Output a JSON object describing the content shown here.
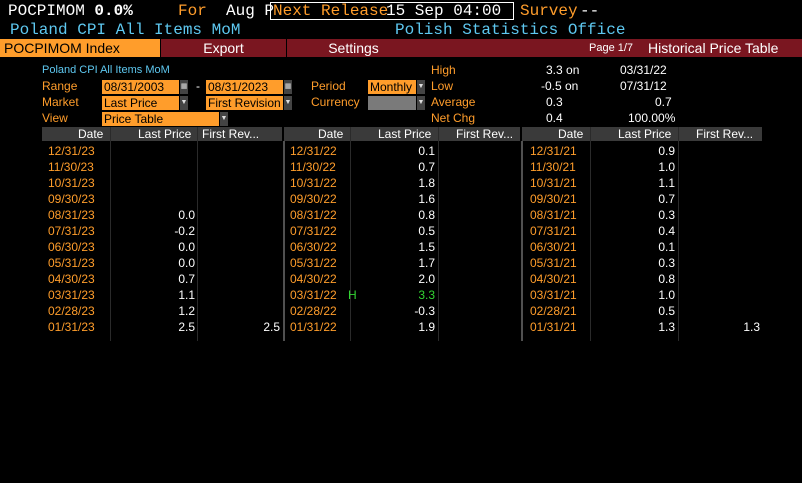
{
  "header": {
    "ticker": "POCPIMOM",
    "last": "0.0%",
    "for_label": "For",
    "for_value": "Aug P",
    "next_release_label": "Next Release",
    "next_release_value": "15 Sep 04:00",
    "survey_label": "Survey",
    "survey_value": "--",
    "security_name": "Poland CPI All Items MoM",
    "source": "Polish Statistics Office"
  },
  "menu": {
    "index_label": "POCPIMOM Index",
    "export_label": "Export",
    "settings_label": "Settings",
    "page_label": "Page 1/7",
    "view_title": "Historical Price Table"
  },
  "controls": {
    "title": "Poland CPI All Items MoM",
    "range_label": "Range",
    "range_start": "08/31/2003",
    "range_sep": "-",
    "range_end": "08/31/2023",
    "period_label": "Period",
    "period_value": "Monthly",
    "market_label": "Market",
    "market_value": "Last Price",
    "market2_value": "First Revision",
    "currency_label": "Currency",
    "currency_value": "",
    "view_label": "View",
    "view_value": "Price Table"
  },
  "stats": {
    "high_label": "High",
    "high_value": "3.3 on",
    "high_date": "03/31/22",
    "low_label": "Low",
    "low_value": "-0.5 on",
    "low_date": "07/31/12",
    "avg_label": "Average",
    "avg_value": "0.3",
    "avg_value2": "0.7",
    "netchg_label": "Net Chg",
    "netchg_value": "0.4",
    "netchg_pct": "100.00%"
  },
  "table": {
    "headers": [
      "Date",
      "Last Price",
      "First Rev..."
    ],
    "col1": [
      {
        "date": "12/31/23",
        "last": "",
        "first": ""
      },
      {
        "date": "11/30/23",
        "last": "",
        "first": ""
      },
      {
        "date": "10/31/23",
        "last": "",
        "first": ""
      },
      {
        "date": "09/30/23",
        "last": "",
        "first": ""
      },
      {
        "date": "08/31/23",
        "last": "0.0",
        "first": ""
      },
      {
        "date": "07/31/23",
        "last": "-0.2",
        "first": ""
      },
      {
        "date": "06/30/23",
        "last": "0.0",
        "first": ""
      },
      {
        "date": "05/31/23",
        "last": "0.0",
        "first": ""
      },
      {
        "date": "04/30/23",
        "last": "0.7",
        "first": ""
      },
      {
        "date": "03/31/23",
        "last": "1.1",
        "first": ""
      },
      {
        "date": "02/28/23",
        "last": "1.2",
        "first": ""
      },
      {
        "date": "01/31/23",
        "last": "2.5",
        "first": "2.5"
      }
    ],
    "col2": [
      {
        "date": "12/31/22",
        "last": "0.1",
        "first": "",
        "mark": ""
      },
      {
        "date": "11/30/22",
        "last": "0.7",
        "first": "",
        "mark": ""
      },
      {
        "date": "10/31/22",
        "last": "1.8",
        "first": "",
        "mark": ""
      },
      {
        "date": "09/30/22",
        "last": "1.6",
        "first": "",
        "mark": ""
      },
      {
        "date": "08/31/22",
        "last": "0.8",
        "first": "",
        "mark": ""
      },
      {
        "date": "07/31/22",
        "last": "0.5",
        "first": "",
        "mark": ""
      },
      {
        "date": "06/30/22",
        "last": "1.5",
        "first": "",
        "mark": ""
      },
      {
        "date": "05/31/22",
        "last": "1.7",
        "first": "",
        "mark": ""
      },
      {
        "date": "04/30/22",
        "last": "2.0",
        "first": "",
        "mark": ""
      },
      {
        "date": "03/31/22",
        "last": "3.3",
        "first": "",
        "mark": "H"
      },
      {
        "date": "02/28/22",
        "last": "-0.3",
        "first": "",
        "mark": ""
      },
      {
        "date": "01/31/22",
        "last": "1.9",
        "first": "",
        "mark": ""
      }
    ],
    "col3": [
      {
        "date": "12/31/21",
        "last": "0.9",
        "first": ""
      },
      {
        "date": "11/30/21",
        "last": "1.0",
        "first": ""
      },
      {
        "date": "10/31/21",
        "last": "1.1",
        "first": ""
      },
      {
        "date": "09/30/21",
        "last": "0.7",
        "first": ""
      },
      {
        "date": "08/31/21",
        "last": "0.3",
        "first": ""
      },
      {
        "date": "07/31/21",
        "last": "0.4",
        "first": ""
      },
      {
        "date": "06/30/21",
        "last": "0.1",
        "first": ""
      },
      {
        "date": "05/31/21",
        "last": "0.3",
        "first": ""
      },
      {
        "date": "04/30/21",
        "last": "0.8",
        "first": ""
      },
      {
        "date": "03/31/21",
        "last": "1.0",
        "first": ""
      },
      {
        "date": "02/28/21",
        "last": "0.5",
        "first": ""
      },
      {
        "date": "01/31/21",
        "last": "1.3",
        "first": "1.3"
      }
    ]
  },
  "colors": {
    "orange": "#ff9d2b",
    "blue": "#5ec8f0",
    "maroon": "#7a1620",
    "green": "#33d433"
  }
}
